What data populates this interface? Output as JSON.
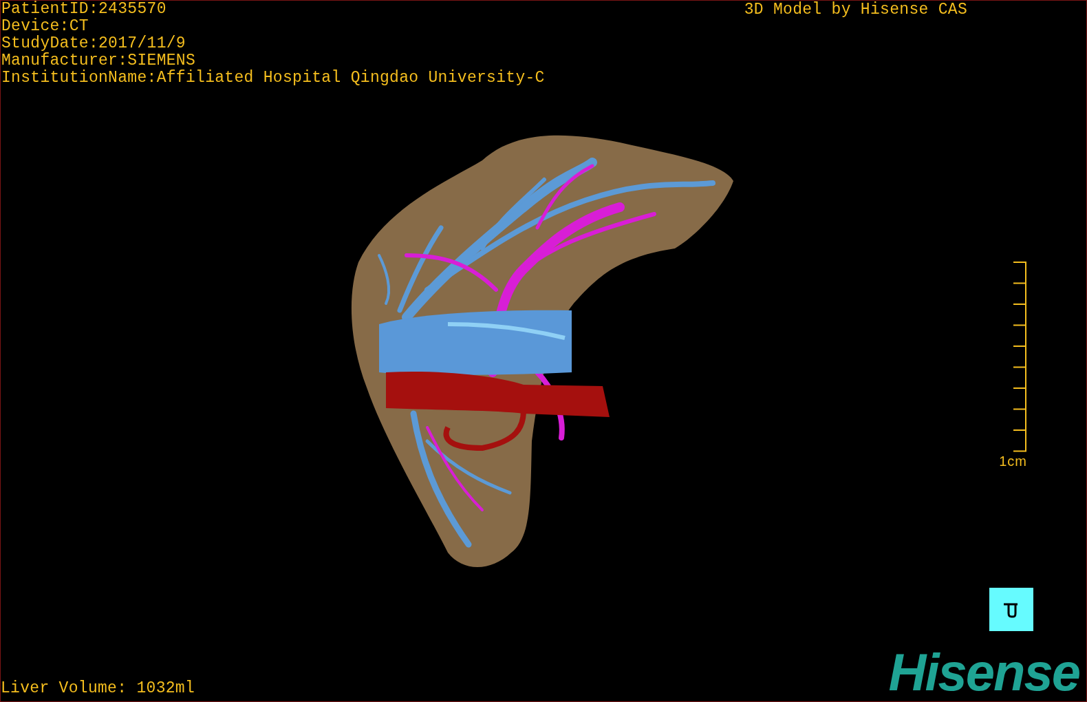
{
  "patient_info": [
    "PatientID:2435570",
    "Device:CT",
    "StudyDate:2017/11/9",
    "Manufacturer:SIEMENS",
    "InstitutionName:Affiliated Hospital Qingdao University-C"
  ],
  "title": "3D Model by Hisense CAS",
  "scale": {
    "label": "1cm"
  },
  "liver_volume": "Liver Volume: 1032ml",
  "logo": "Hisense"
}
